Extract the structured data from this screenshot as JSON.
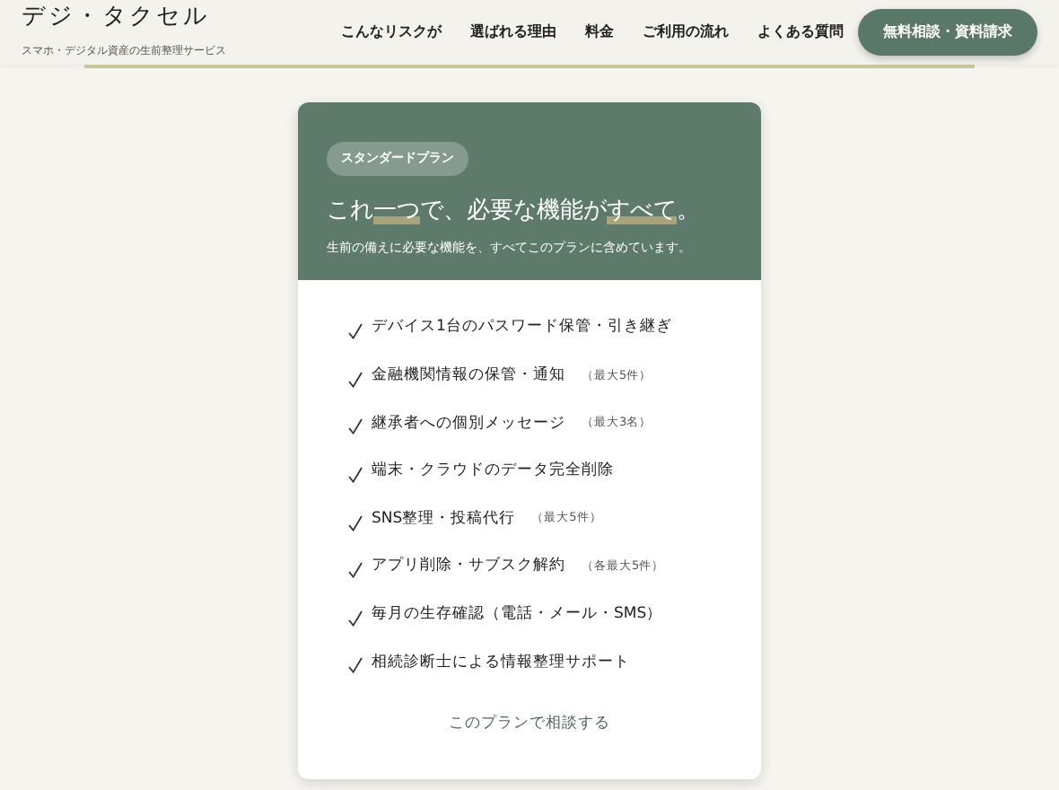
{
  "header": {
    "logo": "デジ・タクセル",
    "tagline": "スマホ・デジタル資産の生前整理サービス",
    "nav": [
      "こんなリスクが",
      "選ばれる理由",
      "料金",
      "ご利用の流れ",
      "よくある質問"
    ],
    "cta": "無料相談・資料請求"
  },
  "plan": {
    "badge": "スタンダードプラン",
    "title": [
      {
        "text": "これ",
        "highlight": false
      },
      {
        "text": "一つ",
        "highlight": true
      },
      {
        "text": "で、必要な機能が",
        "highlight": false
      },
      {
        "text": "すべて",
        "highlight": true
      },
      {
        "text": "。",
        "highlight": false
      }
    ],
    "subtitle": "生前の備えに必要な機能を、すべてこのプランに含めています。",
    "features": [
      {
        "label": "デバイス1台のパスワード保管・引き継ぎ"
      },
      {
        "label": "金融機関情報の保管・通知",
        "note": "（最大5件）"
      },
      {
        "label": "継承者への個別メッセージ",
        "note": "（最大3名）"
      },
      {
        "label": "端末・クラウドのデータ完全削除"
      },
      {
        "label": "SNS整理・投稿代行",
        "note": "（最大5件）"
      },
      {
        "label": "アプリ削除・サブスク解約",
        "note": "（各最大5件）"
      },
      {
        "label": "毎月の生存確認（電話・メール・SMS）"
      },
      {
        "label": "相続診断士による情報整理サポート"
      }
    ],
    "link": "このプランで相談する"
  }
}
